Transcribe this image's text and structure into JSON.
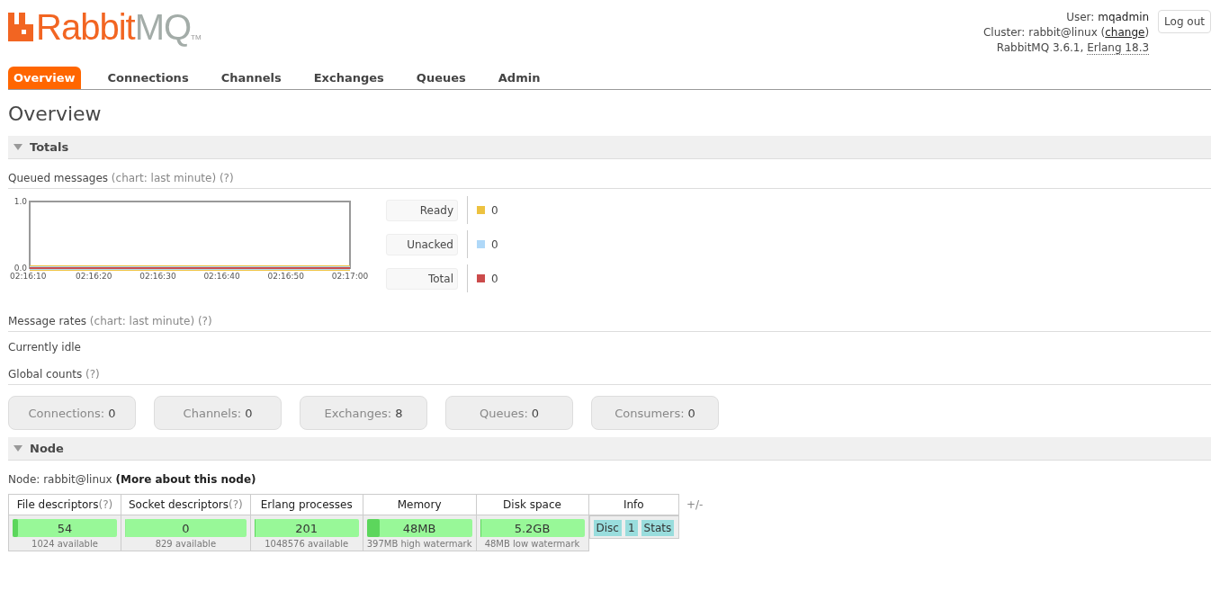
{
  "logo": {
    "primary": "Rabbit",
    "secondary": "MQ",
    "mark": "TM"
  },
  "user_info": {
    "user_label": "User:",
    "user": "mqadmin",
    "cluster_label": "Cluster:",
    "cluster": "rabbit@linux",
    "open_paren": "(",
    "change_link": "change",
    "close_paren": ")",
    "version": "RabbitMQ 3.6.1,",
    "erlang": "Erlang 18.3"
  },
  "logout_button": "Log out",
  "tabs": [
    {
      "label": "Overview",
      "selected": true
    },
    {
      "label": "Connections",
      "selected": false
    },
    {
      "label": "Channels",
      "selected": false
    },
    {
      "label": "Exchanges",
      "selected": false
    },
    {
      "label": "Queues",
      "selected": false
    },
    {
      "label": "Admin",
      "selected": false
    }
  ],
  "page_title": "Overview",
  "totals": {
    "title": "Totals",
    "expanded": true,
    "queued_heading": "Queued messages",
    "queued_chart_note": "(chart: last minute)",
    "queued_help": "(?)",
    "chart_data": {
      "type": "line",
      "categories": [
        "02:16:10",
        "02:16:20",
        "02:16:30",
        "02:16:40",
        "02:16:50",
        "02:17:00"
      ],
      "ylim": [
        0,
        1
      ],
      "yticks": [
        {
          "value": 0,
          "label": "0.0"
        },
        {
          "value": 1,
          "label": "1.0"
        }
      ],
      "series": [
        {
          "name": "Ready",
          "color": "#edc240",
          "values": [
            0,
            0,
            0,
            0,
            0,
            0
          ]
        },
        {
          "name": "Unacked",
          "color": "#afd8f8",
          "values": [
            0,
            0,
            0,
            0,
            0,
            0
          ]
        },
        {
          "name": "Total",
          "color": "#cb4b4b",
          "values": [
            0,
            0,
            0,
            0,
            0,
            0
          ]
        }
      ]
    },
    "legend_values": [
      "0",
      "0",
      "0"
    ],
    "rates_heading": "Message rates",
    "rates_chart_note": "(chart: last minute)",
    "rates_help": "(?)",
    "rates_status": "Currently idle",
    "counts_heading": "Global counts",
    "counts_help": "(?)",
    "counts": [
      {
        "label": "Connections:",
        "value": "0"
      },
      {
        "label": "Channels:",
        "value": "0"
      },
      {
        "label": "Exchanges:",
        "value": "8"
      },
      {
        "label": "Queues:",
        "value": "0"
      },
      {
        "label": "Consumers:",
        "value": "0"
      }
    ]
  },
  "node": {
    "title": "Node",
    "expanded": true,
    "node_label": "Node: rabbit@linux",
    "more_link": "(More about this node)",
    "columns": [
      {
        "label": "File descriptors",
        "help": "(?)"
      },
      {
        "label": "Socket descriptors",
        "help": "(?)"
      },
      {
        "label": "Erlang processes"
      },
      {
        "label": "Memory"
      },
      {
        "label": "Disk space"
      },
      {
        "label": "Info"
      }
    ],
    "toggle": "+/-",
    "stats": [
      {
        "value": "54",
        "level": 0.05,
        "note": "1024 available"
      },
      {
        "value": "0",
        "level": 0,
        "note": "829 available"
      },
      {
        "value": "201",
        "level": 0.0002,
        "note": "1048576 available"
      },
      {
        "value": "48MB",
        "level": 0.12,
        "note": "397MB high watermark"
      },
      {
        "value": "5.2GB",
        "level": 0.01,
        "note": "48MB low watermark"
      }
    ],
    "info_tags": [
      "Disc",
      "1",
      "Stats"
    ]
  }
}
